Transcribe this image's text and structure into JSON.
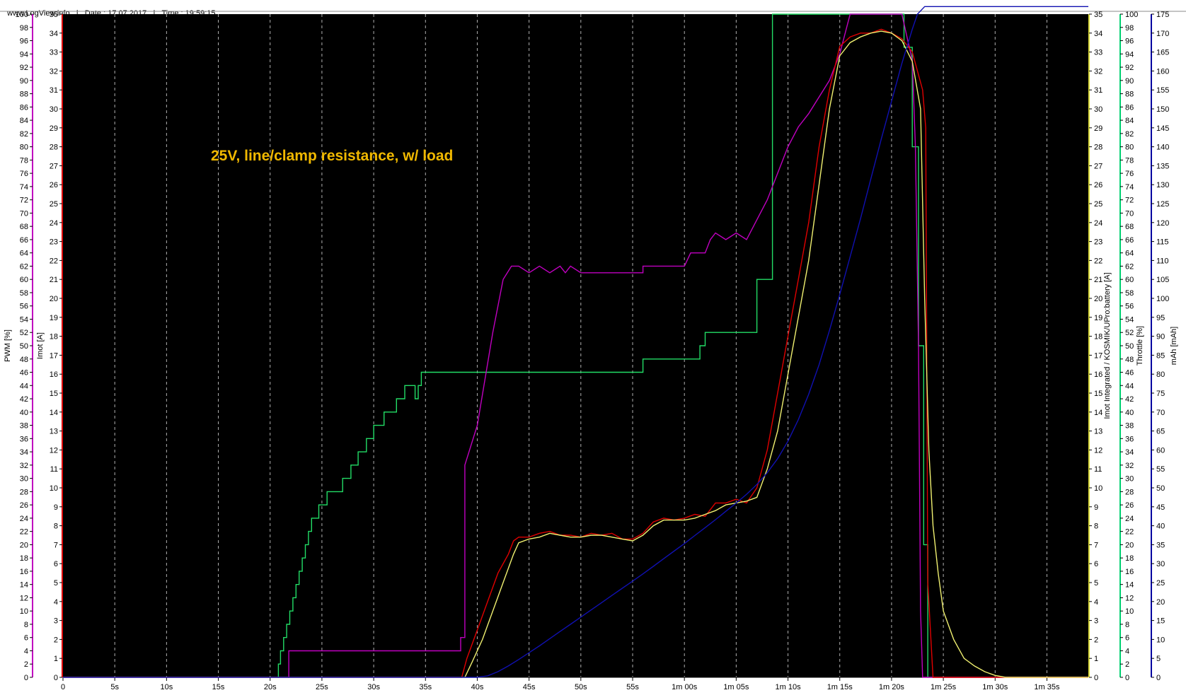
{
  "header": {
    "site": "www.LogView.info",
    "sep1": "|",
    "date": "Date : 17.07.2017",
    "sep2": "|",
    "time": "Time : 19:59:15"
  },
  "chart_data": {
    "type": "line",
    "annotation": "25V, line/clamp resistance, w/ load",
    "x_unit": "s",
    "xlim": [
      0,
      99
    ],
    "x_ticks": [
      {
        "v": 0,
        "label": "0"
      },
      {
        "v": 5,
        "label": "5s"
      },
      {
        "v": 10,
        "label": "10s"
      },
      {
        "v": 15,
        "label": "15s"
      },
      {
        "v": 20,
        "label": "20s"
      },
      {
        "v": 25,
        "label": "25s"
      },
      {
        "v": 30,
        "label": "30s"
      },
      {
        "v": 35,
        "label": "35s"
      },
      {
        "v": 40,
        "label": "40s"
      },
      {
        "v": 45,
        "label": "45s"
      },
      {
        "v": 50,
        "label": "50s"
      },
      {
        "v": 55,
        "label": "55s"
      },
      {
        "v": 60,
        "label": "1m 00s"
      },
      {
        "v": 65,
        "label": "1m 05s"
      },
      {
        "v": 70,
        "label": "1m 10s"
      },
      {
        "v": 75,
        "label": "1m 15s"
      },
      {
        "v": 80,
        "label": "1m 20s"
      },
      {
        "v": 85,
        "label": "1m 25s"
      },
      {
        "v": 90,
        "label": "1m 30s"
      },
      {
        "v": 95,
        "label": "1m 35s"
      }
    ],
    "axes": [
      {
        "id": "pwm",
        "label": "PWM [%]",
        "side": "left",
        "min": 0,
        "max": 100,
        "step": 2,
        "color": "#c000c0"
      },
      {
        "id": "imot",
        "label": "Imot [A]",
        "side": "left",
        "min": 0,
        "max": 35,
        "step": 1,
        "color": "#e00000"
      },
      {
        "id": "imot_int",
        "label": "Imot Integrated / KOSMIK/UPro:battery [A]",
        "side": "right",
        "min": 0,
        "max": 35,
        "step": 1,
        "color": "#e0e040"
      },
      {
        "id": "throttle",
        "label": "Throttle [%]",
        "side": "right",
        "min": 0,
        "max": 100,
        "step": 2,
        "color": "#00d070"
      },
      {
        "id": "mah",
        "label": "mAh [mAh]",
        "side": "right",
        "min": 0,
        "max": 175,
        "step": 5,
        "color": "#0000a0"
      }
    ],
    "series": [
      {
        "name": "Throttle [%]",
        "axis": "throttle",
        "color": "#22dd66",
        "step": true,
        "points": [
          [
            0,
            0
          ],
          [
            20.8,
            0
          ],
          [
            20.8,
            2
          ],
          [
            21,
            4
          ],
          [
            21.3,
            6
          ],
          [
            21.6,
            8
          ],
          [
            21.9,
            10
          ],
          [
            22.2,
            12
          ],
          [
            22.5,
            14
          ],
          [
            22.8,
            16
          ],
          [
            23.1,
            18
          ],
          [
            23.4,
            20
          ],
          [
            23.7,
            22
          ],
          [
            24,
            24
          ],
          [
            24.7,
            26
          ],
          [
            25.5,
            28
          ],
          [
            27,
            30
          ],
          [
            27.8,
            32
          ],
          [
            28.5,
            34
          ],
          [
            29.3,
            36
          ],
          [
            30,
            38
          ],
          [
            31,
            40
          ],
          [
            32.2,
            42
          ],
          [
            33,
            44
          ],
          [
            34,
            42
          ],
          [
            34.3,
            44
          ],
          [
            34.6,
            44
          ],
          [
            34.6,
            46
          ],
          [
            38.5,
            46
          ],
          [
            56,
            46
          ],
          [
            56,
            48
          ],
          [
            60.3,
            48
          ],
          [
            61.5,
            48
          ],
          [
            61.5,
            50
          ],
          [
            62,
            52
          ],
          [
            66,
            52
          ],
          [
            67,
            60
          ],
          [
            68.5,
            100
          ],
          [
            81,
            100
          ],
          [
            81.2,
            95
          ],
          [
            82,
            80
          ],
          [
            82.6,
            50
          ],
          [
            83.1,
            20
          ],
          [
            83.5,
            0
          ],
          [
            99,
            0
          ]
        ]
      },
      {
        "name": "PWM [%]",
        "axis": "pwm",
        "color": "#c000c0",
        "step": false,
        "points": [
          [
            0,
            0
          ],
          [
            21.8,
            0
          ],
          [
            21.8,
            4
          ],
          [
            38.4,
            4
          ],
          [
            38.4,
            6
          ],
          [
            38.8,
            6
          ],
          [
            38.8,
            32
          ],
          [
            40,
            38
          ],
          [
            41.5,
            52
          ],
          [
            42.5,
            60
          ],
          [
            43.3,
            62
          ],
          [
            44,
            62
          ],
          [
            45,
            61
          ],
          [
            46,
            62
          ],
          [
            47,
            61
          ],
          [
            48,
            62
          ],
          [
            48.5,
            61
          ],
          [
            49,
            62
          ],
          [
            50,
            61
          ],
          [
            56,
            61
          ],
          [
            56,
            62
          ],
          [
            57,
            62
          ],
          [
            58,
            62
          ],
          [
            60,
            62
          ],
          [
            60.6,
            64
          ],
          [
            62,
            64
          ],
          [
            62.5,
            66
          ],
          [
            63,
            67
          ],
          [
            64,
            66
          ],
          [
            65,
            67
          ],
          [
            66,
            66
          ],
          [
            68,
            72
          ],
          [
            70,
            80
          ],
          [
            71,
            83
          ],
          [
            72,
            85
          ],
          [
            74,
            90
          ],
          [
            75,
            94
          ],
          [
            76,
            100
          ],
          [
            80,
            100
          ],
          [
            81,
            100
          ],
          [
            82,
            93
          ],
          [
            82.3,
            80
          ],
          [
            82.6,
            50
          ],
          [
            82.8,
            10
          ],
          [
            83,
            0
          ],
          [
            99,
            0
          ]
        ]
      },
      {
        "name": "Imot [A]",
        "axis": "imot",
        "color": "#e00000",
        "step": false,
        "points": [
          [
            0,
            0
          ],
          [
            38.5,
            0
          ],
          [
            39,
            1
          ],
          [
            40,
            2.5
          ],
          [
            41,
            4
          ],
          [
            42,
            5.5
          ],
          [
            43,
            6.5
          ],
          [
            43.5,
            7.2
          ],
          [
            44,
            7.4
          ],
          [
            45,
            7.4
          ],
          [
            46,
            7.6
          ],
          [
            47,
            7.7
          ],
          [
            48,
            7.5
          ],
          [
            49,
            7.5
          ],
          [
            50,
            7.4
          ],
          [
            51,
            7.6
          ],
          [
            52,
            7.5
          ],
          [
            53,
            7.6
          ],
          [
            54,
            7.3
          ],
          [
            55,
            7.3
          ],
          [
            56,
            7.6
          ],
          [
            57,
            8.2
          ],
          [
            58,
            8.4
          ],
          [
            59,
            8.3
          ],
          [
            60,
            8.4
          ],
          [
            61,
            8.6
          ],
          [
            62,
            8.5
          ],
          [
            63,
            9.2
          ],
          [
            64,
            9.2
          ],
          [
            65,
            9.4
          ],
          [
            66,
            9.2
          ],
          [
            67,
            10
          ],
          [
            68,
            12
          ],
          [
            69,
            15
          ],
          [
            70,
            18
          ],
          [
            71,
            21
          ],
          [
            72,
            24
          ],
          [
            73,
            28
          ],
          [
            74,
            31
          ],
          [
            75,
            33.3
          ],
          [
            76,
            33.8
          ],
          [
            77,
            34
          ],
          [
            78,
            34
          ],
          [
            79,
            34.2
          ],
          [
            80,
            34
          ],
          [
            81,
            33.7
          ],
          [
            82,
            33
          ],
          [
            83,
            31
          ],
          [
            83.3,
            29
          ],
          [
            83.5,
            5
          ],
          [
            84,
            0
          ],
          [
            99,
            0
          ]
        ]
      },
      {
        "name": "Imot Integrated / KOSMIK/UPro:battery [A]",
        "axis": "imot_int",
        "color": "#f0f070",
        "step": false,
        "points": [
          [
            0,
            0
          ],
          [
            38.8,
            0
          ],
          [
            39.5,
            0.8
          ],
          [
            40.5,
            2
          ],
          [
            41.5,
            3.5
          ],
          [
            42.5,
            5
          ],
          [
            43.5,
            6.5
          ],
          [
            44,
            7.1
          ],
          [
            45,
            7.3
          ],
          [
            46,
            7.4
          ],
          [
            47,
            7.6
          ],
          [
            48,
            7.5
          ],
          [
            49,
            7.4
          ],
          [
            50,
            7.4
          ],
          [
            51,
            7.5
          ],
          [
            52,
            7.5
          ],
          [
            53,
            7.4
          ],
          [
            54,
            7.3
          ],
          [
            55,
            7.2
          ],
          [
            56,
            7.5
          ],
          [
            57,
            8
          ],
          [
            58,
            8.3
          ],
          [
            59,
            8.3
          ],
          [
            60,
            8.3
          ],
          [
            61,
            8.4
          ],
          [
            62,
            8.6
          ],
          [
            63,
            8.8
          ],
          [
            64,
            9.1
          ],
          [
            65,
            9.2
          ],
          [
            66,
            9.3
          ],
          [
            67,
            9.5
          ],
          [
            68,
            11
          ],
          [
            69,
            13
          ],
          [
            70,
            16
          ],
          [
            71,
            19
          ],
          [
            72,
            22
          ],
          [
            73,
            26
          ],
          [
            74,
            30
          ],
          [
            75,
            32.8
          ],
          [
            76,
            33.5
          ],
          [
            77,
            33.8
          ],
          [
            78,
            34
          ],
          [
            79,
            34.1
          ],
          [
            80,
            34
          ],
          [
            81,
            33.6
          ],
          [
            82,
            32.5
          ],
          [
            82.8,
            30
          ],
          [
            83.2,
            20
          ],
          [
            83.6,
            12
          ],
          [
            84,
            8
          ],
          [
            84.5,
            5.5
          ],
          [
            85,
            3.5
          ],
          [
            86,
            2
          ],
          [
            87,
            1
          ],
          [
            88,
            0.6
          ],
          [
            89,
            0.3
          ],
          [
            90,
            0.1
          ],
          [
            91,
            0
          ],
          [
            99,
            0
          ]
        ]
      },
      {
        "name": "mAh [mAh]",
        "axis": "mah",
        "color": "#1010b0",
        "step": false,
        "points": [
          [
            0,
            0
          ],
          [
            40,
            0
          ],
          [
            41,
            0.4
          ],
          [
            42,
            1.5
          ],
          [
            43,
            3
          ],
          [
            44,
            4.7
          ],
          [
            45,
            6.5
          ],
          [
            46,
            8.3
          ],
          [
            47,
            10.2
          ],
          [
            48,
            12.1
          ],
          [
            49,
            14
          ],
          [
            50,
            15.9
          ],
          [
            51,
            17.8
          ],
          [
            52,
            19.7
          ],
          [
            53,
            21.6
          ],
          [
            54,
            23.5
          ],
          [
            55,
            25.4
          ],
          [
            56,
            27.3
          ],
          [
            57,
            29.3
          ],
          [
            58,
            31.3
          ],
          [
            59,
            33.3
          ],
          [
            60,
            35.3
          ],
          [
            61,
            37.4
          ],
          [
            62,
            39.5
          ],
          [
            63,
            41.6
          ],
          [
            64,
            43.8
          ],
          [
            65,
            46
          ],
          [
            66,
            48.3
          ],
          [
            67,
            50.9
          ],
          [
            68,
            54
          ],
          [
            69,
            57.7
          ],
          [
            70,
            62.3
          ],
          [
            71,
            68
          ],
          [
            72,
            74.7
          ],
          [
            73,
            82.5
          ],
          [
            74,
            91.5
          ],
          [
            75,
            101
          ],
          [
            76,
            111
          ],
          [
            77,
            121
          ],
          [
            78,
            131.5
          ],
          [
            79,
            142
          ],
          [
            80,
            152
          ],
          [
            81,
            162
          ],
          [
            82,
            171
          ],
          [
            82.5,
            175
          ],
          [
            83.2,
            177
          ],
          [
            99,
            177
          ]
        ]
      }
    ]
  }
}
